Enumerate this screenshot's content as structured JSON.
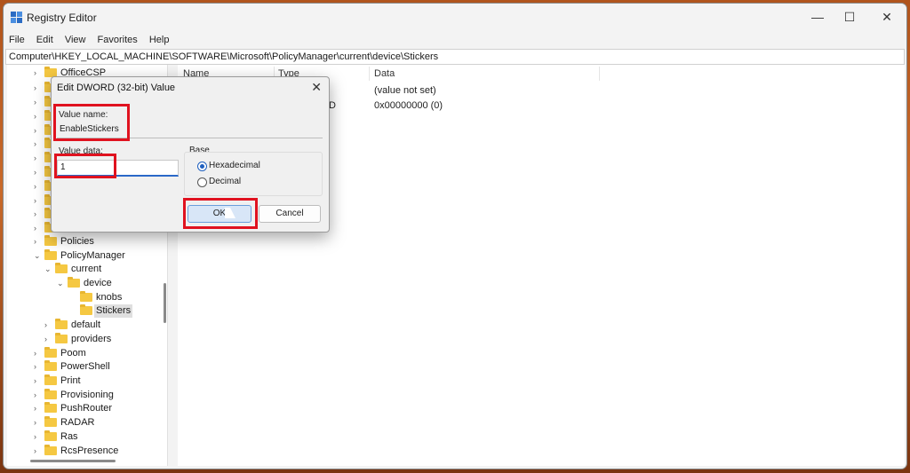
{
  "window": {
    "title": "Registry Editor"
  },
  "menu": [
    "File",
    "Edit",
    "View",
    "Favorites",
    "Help"
  ],
  "address": "Computer\\HKEY_LOCAL_MACHINE\\SOFTWARE\\Microsoft\\PolicyManager\\current\\device\\Stickers",
  "tree": [
    {
      "label": "OfficeCSP",
      "expanded": false
    },
    {
      "label": "Policies",
      "expanded": false
    },
    {
      "label": "PolicyManager",
      "expanded": true
    },
    {
      "label": "current",
      "expanded": true
    },
    {
      "label": "device",
      "expanded": true
    },
    {
      "label": "knobs",
      "expanded": false
    },
    {
      "label": "Stickers",
      "expanded": false,
      "selected": true
    },
    {
      "label": "default",
      "expanded": false
    },
    {
      "label": "providers",
      "expanded": false
    },
    {
      "label": "Poom",
      "expanded": false
    },
    {
      "label": "PowerShell",
      "expanded": false
    },
    {
      "label": "Print",
      "expanded": false
    },
    {
      "label": "Provisioning",
      "expanded": false
    },
    {
      "label": "PushRouter",
      "expanded": false
    },
    {
      "label": "RADAR",
      "expanded": false
    },
    {
      "label": "Ras",
      "expanded": false
    },
    {
      "label": "RcsPresence",
      "expanded": false
    }
  ],
  "list": {
    "headers": [
      "Name",
      "Type",
      "Data"
    ],
    "rows": [
      {
        "type_frag": "",
        "data": "(value not set)"
      },
      {
        "type_frag": "D",
        "data": "0x00000000 (0)"
      }
    ]
  },
  "dialog": {
    "title": "Edit DWORD (32-bit) Value",
    "value_name_label": "Value name:",
    "value_name": "EnableStickers",
    "value_data_label": "Value data:",
    "value_data": "1",
    "base_label": "Base",
    "base_options": [
      "Hexadecimal",
      "Decimal"
    ],
    "base_selected": "Hexadecimal",
    "ok_label": "OK",
    "cancel_label": "Cancel"
  },
  "colors": {
    "highlight": "#e0121f",
    "accent": "#1e5fbf"
  }
}
